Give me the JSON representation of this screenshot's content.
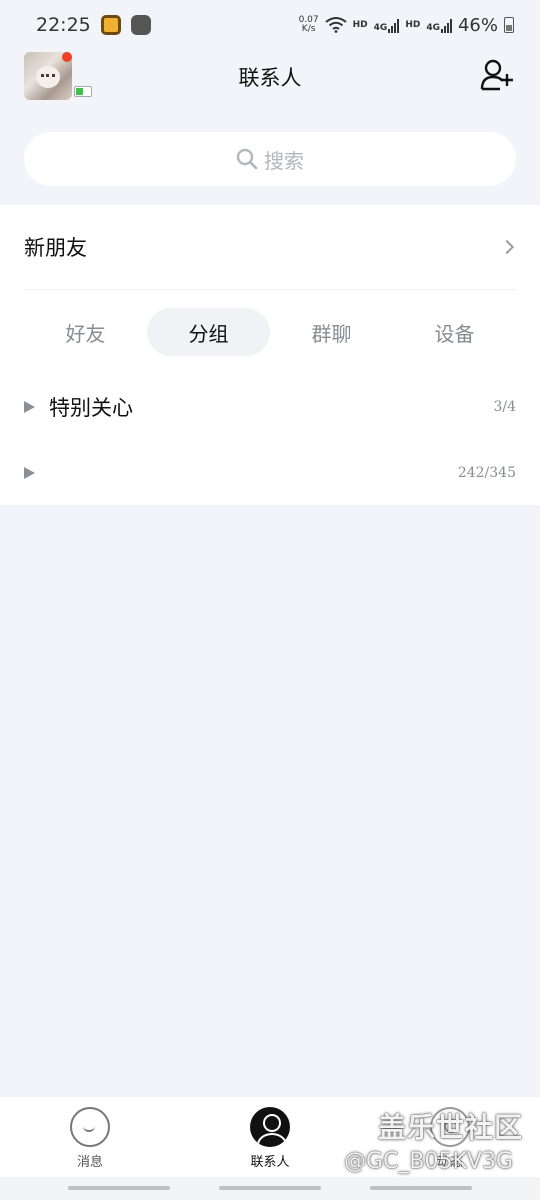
{
  "status_bar": {
    "time": "22:25",
    "net_speed_top": "0.07",
    "net_speed_bottom": "K/s",
    "hd1": "HD",
    "sig1": "4G",
    "hd2": "HD",
    "sig2": "4G",
    "battery": "46%"
  },
  "header": {
    "title": "联系人"
  },
  "search": {
    "placeholder": "搜索"
  },
  "new_friends": {
    "label": "新朋友"
  },
  "tabs": [
    {
      "label": "好友"
    },
    {
      "label": "分组",
      "active": true
    },
    {
      "label": "群聊"
    },
    {
      "label": "设备"
    }
  ],
  "groups": [
    {
      "name": "特别关心",
      "count": "3/4"
    },
    {
      "name": "",
      "count": "242/345"
    }
  ],
  "bottom_nav": {
    "messages": "消息",
    "contacts": "联系人",
    "trends": "动态"
  },
  "watermark": {
    "line1": "盖乐世社区",
    "line2": "@GC_B05KV3G"
  }
}
